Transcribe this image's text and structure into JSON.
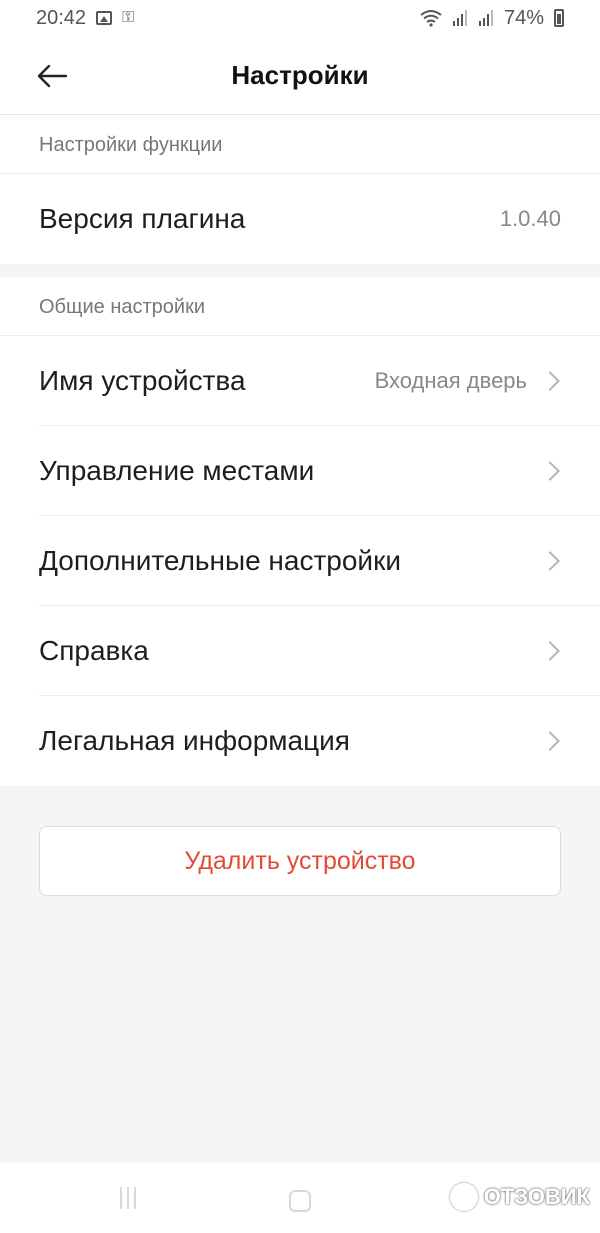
{
  "status_bar": {
    "time": "20:42",
    "battery_percent": "74%",
    "icons": [
      "image-icon",
      "key-icon",
      "wifi-icon",
      "signal-icon",
      "signal-icon",
      "battery-icon"
    ]
  },
  "header": {
    "title": "Настройки",
    "back_icon": "arrow-left-icon"
  },
  "sections": {
    "feature_settings": {
      "title": "Настройки функции",
      "plugin_version": {
        "label": "Версия плагина",
        "value": "1.0.40"
      }
    },
    "general_settings": {
      "title": "Общие настройки",
      "items": [
        {
          "label": "Имя устройства",
          "value": "Входная дверь"
        },
        {
          "label": "Управление местами"
        },
        {
          "label": "Дополнительные настройки"
        },
        {
          "label": "Справка"
        },
        {
          "label": "Легальная информация"
        }
      ]
    }
  },
  "delete_button": {
    "label": "Удалить устройство"
  },
  "watermark": {
    "text": "ОТЗОВИК"
  },
  "colors": {
    "accent_red": "#e34b35",
    "background": "#f5f5f5",
    "card": "#ffffff",
    "secondary_text": "#888888"
  }
}
